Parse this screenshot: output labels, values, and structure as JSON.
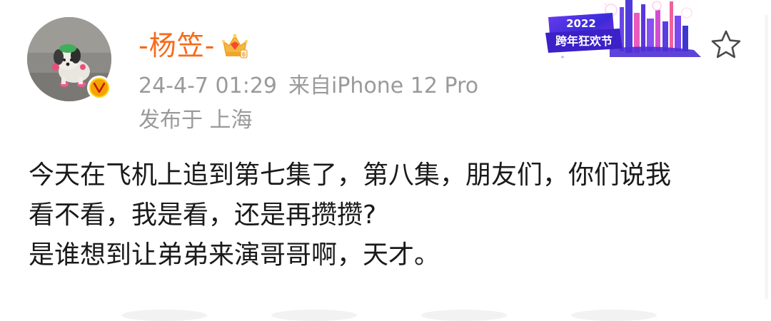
{
  "author": {
    "name": "-杨笠-",
    "avatar_icon": "dog-photo-avatar",
    "verified_icon": "verified-v-badge",
    "verified_color": "#f5a300",
    "vip_icon": "crown-vip-icon",
    "name_color": "#f86a1a"
  },
  "meta": {
    "timestamp": "24-4-7 01:29",
    "source": "来自iPhone 12 Pro",
    "location": "发布于 上海"
  },
  "banner": {
    "year": "2022",
    "title": "跨年狂欢节"
  },
  "actions": {
    "favorite_icon": "star-outline-icon"
  },
  "post": {
    "lines": [
      "今天在飞机上追到第七集了，第八集，朋友们，你们说我",
      "看不看，我是看，还是再攒攒?",
      "是谁想到让弟弟来演哥哥啊，天才。"
    ]
  }
}
